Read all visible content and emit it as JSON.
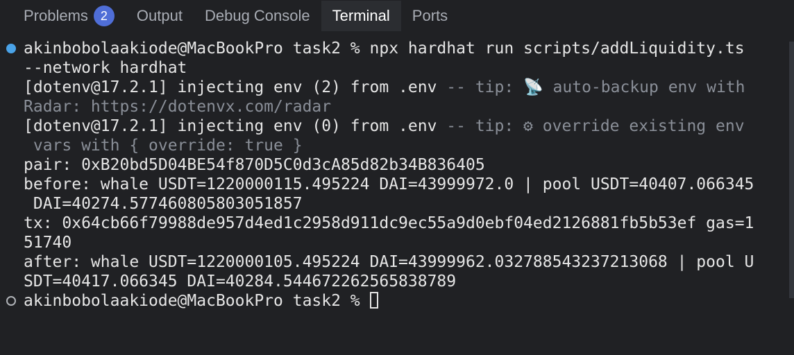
{
  "tabs": {
    "problems": {
      "label": "Problems",
      "badge": "2"
    },
    "output": {
      "label": "Output"
    },
    "debug": {
      "label": "Debug Console"
    },
    "terminal": {
      "label": "Terminal"
    },
    "ports": {
      "label": "Ports"
    }
  },
  "terminal": {
    "lines": [
      "akinbobolaakiode@MacBookPro task2 % npx hardhat run scripts/addLiquidity.ts",
      "--network hardhat",
      "[dotenv@17.2.1] injecting env (2) from .env ",
      "Radar: https://dotenvx.com/radar",
      "[dotenv@17.2.1] injecting env (0) from .env ",
      " vars with { override: true }",
      "pair: 0xB20bd5D04BE54f870D5C0d3cA85d82b34B836405",
      "before: whale USDT=1220000115.495224 DAI=43999972.0 | pool USDT=40407.066345",
      " DAI=40274.577460805803051857",
      "tx: 0x64cb66f79988de957d4ed1c2958d911dc9ec55a9d0ebf04ed2126881fb5b53ef gas=1",
      "51740",
      "after: whale USDT=1220000105.495224 DAI=43999962.032788543237213068 | pool U",
      "SDT=40417.066345 DAI=40284.544672262565838789",
      "akinbobolaakiode@MacBookPro task2 % "
    ],
    "tip1": "-- tip: 📡 auto-backup env with",
    "tip2": "-- tip: ⚙ override existing env"
  },
  "colors": {
    "background": "#202124",
    "text": "#e6e6e6",
    "dim_text": "#8a8f98",
    "badge": "#4f6ed7",
    "success_dot": "#4aa3e8"
  },
  "icons": {
    "command_status": "filled-circle",
    "prompt_status": "hollow-circle",
    "cursor": "block-cursor"
  }
}
